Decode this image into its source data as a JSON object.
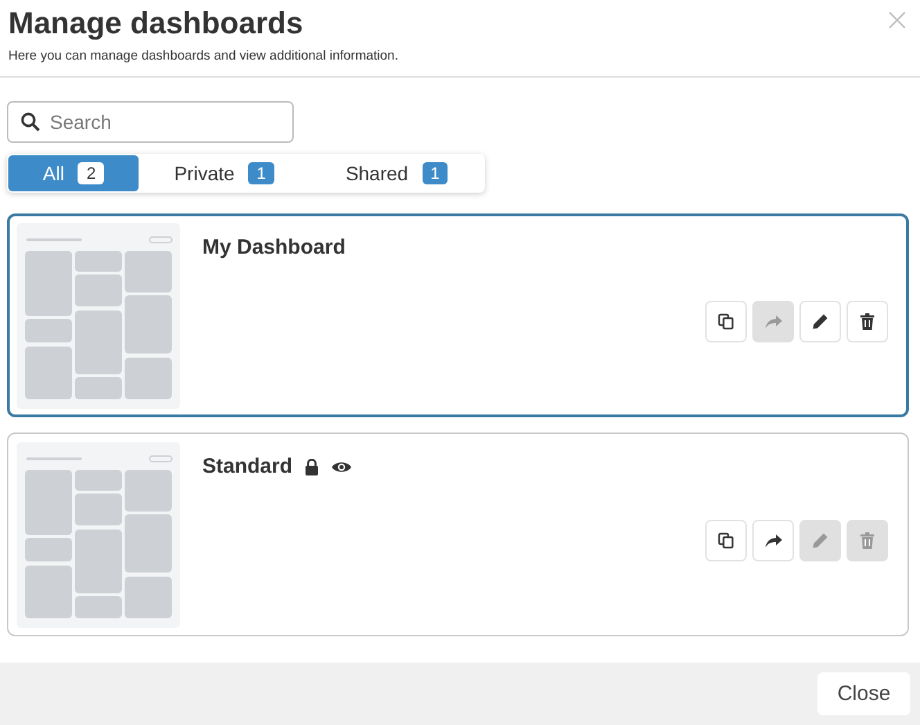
{
  "dialog": {
    "title": "Manage dashboards",
    "subtitle": "Here you can manage dashboards and view additional information."
  },
  "search": {
    "placeholder": "Search"
  },
  "tabs": [
    {
      "label": "All",
      "count": "2",
      "selected": true
    },
    {
      "label": "Private",
      "count": "1",
      "selected": false
    },
    {
      "label": "Shared",
      "count": "1",
      "selected": false
    }
  ],
  "dashboards": [
    {
      "name": "My Dashboard",
      "selected": true,
      "actions": [
        {
          "kind": "copy",
          "disabled": false
        },
        {
          "kind": "share",
          "disabled": true
        },
        {
          "kind": "edit",
          "disabled": false
        },
        {
          "kind": "delete",
          "disabled": false
        }
      ]
    },
    {
      "name": "Standard",
      "selected": false,
      "badges": [
        {
          "kind": "lock"
        },
        {
          "kind": "eye"
        }
      ],
      "actions": [
        {
          "kind": "copy",
          "disabled": false
        },
        {
          "kind": "share",
          "disabled": false
        },
        {
          "kind": "edit",
          "disabled": true
        },
        {
          "kind": "delete",
          "disabled": true
        }
      ]
    }
  ],
  "footer": {
    "close_button": "Close"
  }
}
